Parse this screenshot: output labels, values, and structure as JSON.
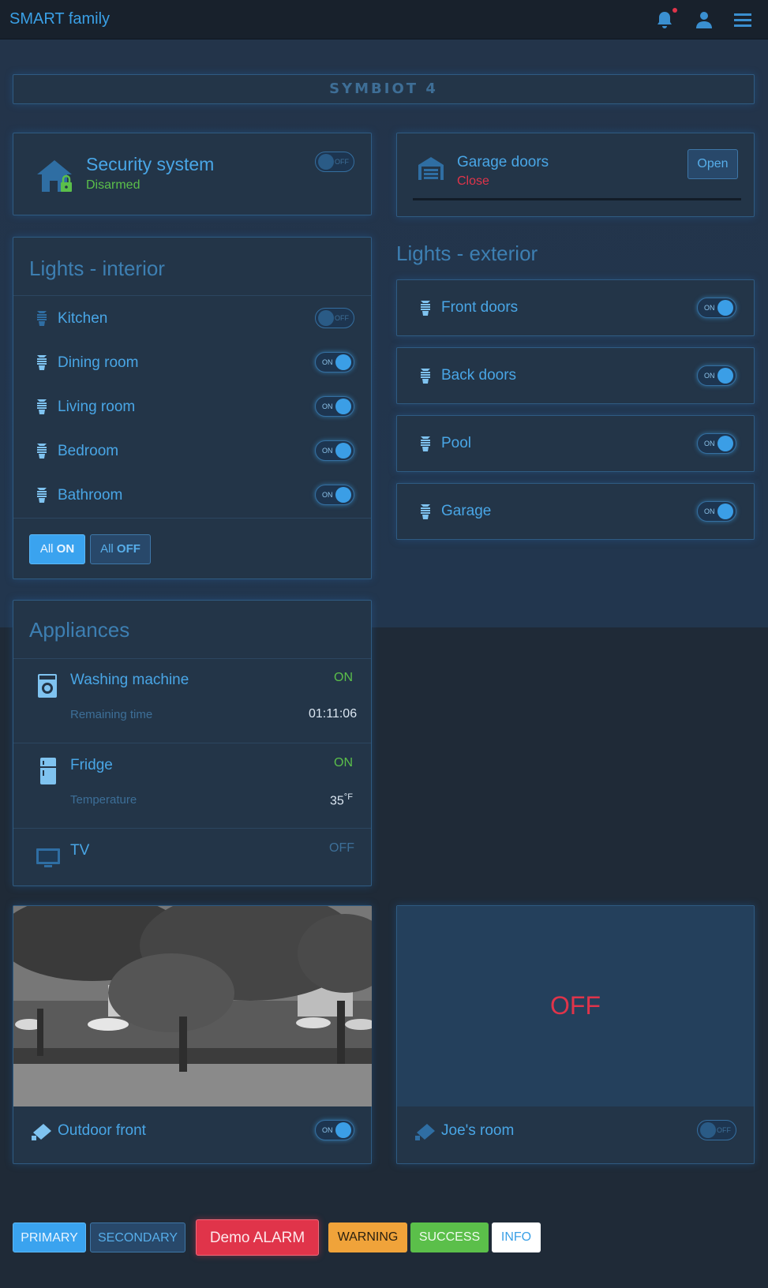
{
  "topbar": {
    "title": "SMART family",
    "icons": [
      "bell-icon",
      "user-icon",
      "menu-icon"
    ]
  },
  "logo": {
    "text": "SYMBIOT 4"
  },
  "security": {
    "title": "Security system",
    "status": "Disarmed",
    "toggle": {
      "state": "OFF"
    }
  },
  "garage": {
    "title": "Garage doors",
    "status": "Close",
    "button": "Open"
  },
  "lights_interior": {
    "title": "Lights - interior",
    "items": [
      {
        "label": "Kitchen",
        "state": "OFF"
      },
      {
        "label": "Dining room",
        "state": "ON"
      },
      {
        "label": "Living room",
        "state": "ON"
      },
      {
        "label": "Bedroom",
        "state": "ON"
      },
      {
        "label": "Bathroom",
        "state": "ON"
      }
    ],
    "all_on": {
      "prefix": "All",
      "bold": "ON"
    },
    "all_off": {
      "prefix": "All",
      "bold": "OFF"
    }
  },
  "lights_exterior": {
    "title": "Lights - exterior",
    "items": [
      {
        "label": "Front doors",
        "state": "ON"
      },
      {
        "label": "Back doors",
        "state": "ON"
      },
      {
        "label": "Pool",
        "state": "ON"
      },
      {
        "label": "Garage",
        "state": "ON"
      }
    ]
  },
  "appliances": {
    "title": "Appliances",
    "washing": {
      "title": "Washing machine",
      "state": "ON",
      "sub": "Remaining time",
      "value": "01:11:06"
    },
    "fridge": {
      "title": "Fridge",
      "state": "ON",
      "sub": "Temperature",
      "value": "35",
      "unit": "°F"
    },
    "tv": {
      "title": "TV",
      "state": "OFF"
    }
  },
  "cameras": [
    {
      "label": "Outdoor front",
      "state": "ON"
    },
    {
      "label": "Joe's room",
      "state": "OFF",
      "screen_text": "OFF"
    }
  ],
  "bottom_buttons": {
    "primary": "PRIMARY",
    "secondary": "SECONDARY",
    "alarm": "Demo ALARM",
    "warning": "WARNING",
    "success": "SUCCESS",
    "info": "INFO"
  },
  "colors": {
    "accent": "#3aa0e6",
    "success": "#5bbf4a",
    "danger": "#e0344a",
    "warning": "#f0a33a"
  }
}
